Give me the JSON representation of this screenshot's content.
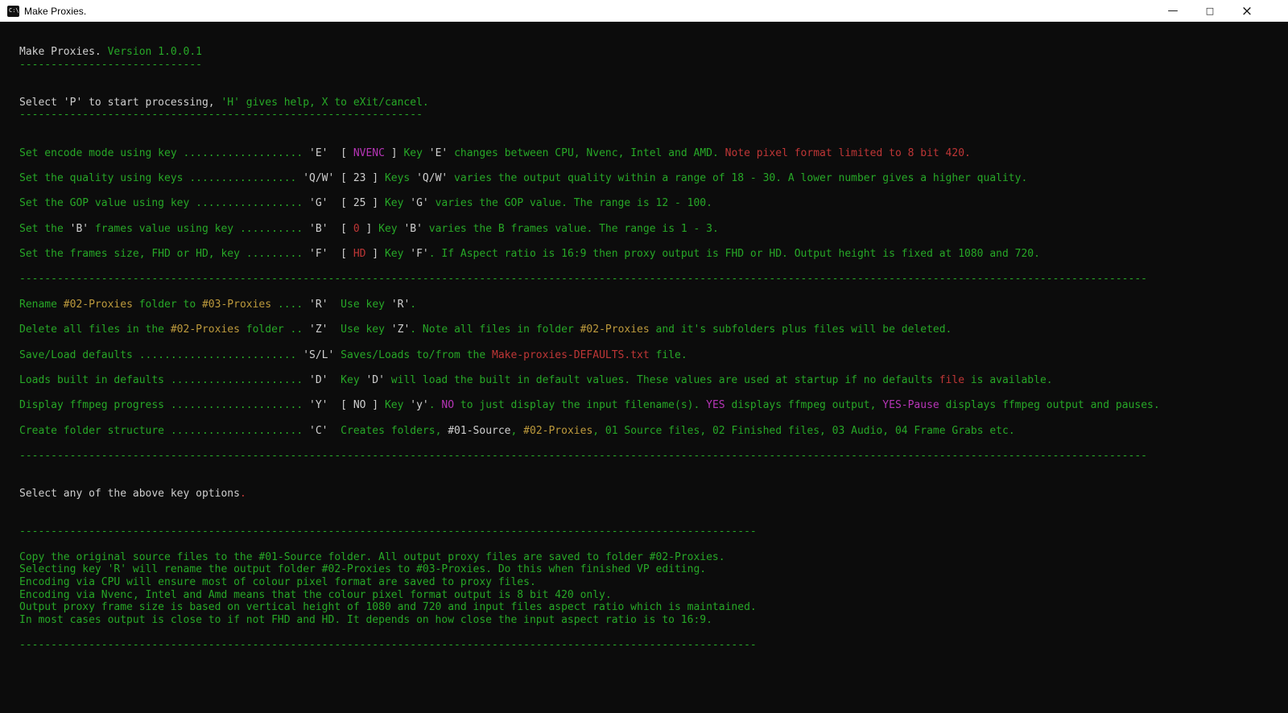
{
  "window": {
    "title": "Make Proxies.",
    "icon_glyph": "C:\\",
    "controls": {
      "minimize": "—",
      "maximize": "□",
      "close": "×"
    }
  },
  "colors": {
    "g": "#27a827",
    "w": "#cfcfcf",
    "r": "#bf3636",
    "m": "#b735b7",
    "y": "#bd9a3c",
    "titlebar_bg": "#ffffff",
    "console_bg": "#0c0c0c"
  },
  "console": {
    "lines": [
      [
        {
          "c": "w",
          "t": "Make Proxies."
        },
        {
          "c": "g",
          "t": " Version 1.0.0.1"
        }
      ],
      [
        {
          "c": "g",
          "rep": "-",
          "n": 29
        }
      ],
      [],
      [],
      [
        {
          "c": "w",
          "t": "Select 'P' to start processing, "
        },
        {
          "c": "g",
          "t": "'H' gives help, X to eXit/cancel."
        }
      ],
      [
        {
          "c": "g",
          "rep": "-",
          "n": 64
        }
      ],
      [],
      [],
      [
        {
          "c": "g",
          "t": "Set encode mode using key ................... "
        },
        {
          "c": "w",
          "t": "'E'  [ "
        },
        {
          "c": "m",
          "t": "NVENC"
        },
        {
          "c": "w",
          "t": " ] "
        },
        {
          "c": "g",
          "t": "Key "
        },
        {
          "c": "w",
          "t": "'E'"
        },
        {
          "c": "g",
          "t": " changes between CPU, Nvenc, Intel and AMD. "
        },
        {
          "c": "r",
          "t": "Note pixel format limited to 8 bit 420."
        }
      ],
      [],
      [
        {
          "c": "g",
          "t": "Set the quality using keys ................. "
        },
        {
          "c": "w",
          "t": "'Q/W' [ 23 ] "
        },
        {
          "c": "g",
          "t": "Keys "
        },
        {
          "c": "w",
          "t": "'Q/W'"
        },
        {
          "c": "g",
          "t": " varies the output quality within a range of 18 - 30. A lower number gives a higher quality."
        }
      ],
      [],
      [
        {
          "c": "g",
          "t": "Set the GOP value using key ................. "
        },
        {
          "c": "w",
          "t": "'G'  [ 25 ] "
        },
        {
          "c": "g",
          "t": "Key "
        },
        {
          "c": "w",
          "t": "'G'"
        },
        {
          "c": "g",
          "t": " varies the GOP value. The range is 12 - 100."
        }
      ],
      [],
      [
        {
          "c": "g",
          "t": "Set the "
        },
        {
          "c": "w",
          "t": "'B'"
        },
        {
          "c": "g",
          "t": " frames value using key .......... "
        },
        {
          "c": "w",
          "t": "'B'  [ "
        },
        {
          "c": "r",
          "t": "0"
        },
        {
          "c": "w",
          "t": " ] "
        },
        {
          "c": "g",
          "t": "Key "
        },
        {
          "c": "w",
          "t": "'B'"
        },
        {
          "c": "g",
          "t": " varies the B frames value. The range is 1 - 3."
        }
      ],
      [],
      [
        {
          "c": "g",
          "t": "Set the frames size, FHD or HD, key ......... "
        },
        {
          "c": "w",
          "t": "'F'  [ "
        },
        {
          "c": "r",
          "t": "HD"
        },
        {
          "c": "w",
          "t": " ] "
        },
        {
          "c": "g",
          "t": "Key "
        },
        {
          "c": "w",
          "t": "'F'"
        },
        {
          "c": "g",
          "t": ". If Aspect ratio is 16:9 then proxy output is FHD or HD. Output height is fixed at 1080 and 720."
        }
      ],
      [],
      [
        {
          "c": "g",
          "rep": "-",
          "n": 179
        }
      ],
      [],
      [
        {
          "c": "g",
          "t": "Rename "
        },
        {
          "c": "y",
          "t": "#02-Proxies"
        },
        {
          "c": "g",
          "t": " folder to "
        },
        {
          "c": "y",
          "t": "#03-Proxies"
        },
        {
          "c": "g",
          "t": " .... "
        },
        {
          "c": "w",
          "t": "'R'"
        },
        {
          "c": "g",
          "t": "  Use key "
        },
        {
          "c": "w",
          "t": "'R'"
        },
        {
          "c": "g",
          "t": "."
        }
      ],
      [],
      [
        {
          "c": "g",
          "t": "Delete all files in the "
        },
        {
          "c": "y",
          "t": "#02-Proxies"
        },
        {
          "c": "g",
          "t": " folder .. "
        },
        {
          "c": "w",
          "t": "'Z'"
        },
        {
          "c": "g",
          "t": "  Use key "
        },
        {
          "c": "w",
          "t": "'Z'"
        },
        {
          "c": "g",
          "t": ". Note all files in folder "
        },
        {
          "c": "y",
          "t": "#02-Proxies"
        },
        {
          "c": "g",
          "t": " and it's subfolders plus files will be deleted."
        }
      ],
      [],
      [
        {
          "c": "g",
          "t": "Save/Load defaults ......................... "
        },
        {
          "c": "w",
          "t": "'S/L'"
        },
        {
          "c": "g",
          "t": " Saves/Loads to/from the "
        },
        {
          "c": "r",
          "t": "Make-proxies-DEFAULTS.txt"
        },
        {
          "c": "g",
          "t": " file."
        }
      ],
      [],
      [
        {
          "c": "g",
          "t": "Loads built in defaults ..................... "
        },
        {
          "c": "w",
          "t": "'D'"
        },
        {
          "c": "g",
          "t": "  Key "
        },
        {
          "c": "w",
          "t": "'D'"
        },
        {
          "c": "g",
          "t": " will load the built in default values. These values are used at startup if no defaults "
        },
        {
          "c": "r",
          "t": "file"
        },
        {
          "c": "g",
          "t": " is available."
        }
      ],
      [],
      [
        {
          "c": "g",
          "t": "Display ffmpeg progress ..................... "
        },
        {
          "c": "w",
          "t": "'Y'  [ NO ] "
        },
        {
          "c": "g",
          "t": "Key "
        },
        {
          "c": "w",
          "t": "'y'"
        },
        {
          "c": "g",
          "t": ". "
        },
        {
          "c": "m",
          "t": "NO"
        },
        {
          "c": "g",
          "t": " to just display the input filename(s). "
        },
        {
          "c": "m",
          "t": "YES"
        },
        {
          "c": "g",
          "t": " displays ffmpeg output, "
        },
        {
          "c": "m",
          "t": "YES-Pause"
        },
        {
          "c": "g",
          "t": " displays ffmpeg output and pauses."
        }
      ],
      [],
      [
        {
          "c": "g",
          "t": "Create folder structure ..................... "
        },
        {
          "c": "w",
          "t": "'C'"
        },
        {
          "c": "g",
          "t": "  Creates folders, "
        },
        {
          "c": "w",
          "t": "#01-Source"
        },
        {
          "c": "g",
          "t": ", "
        },
        {
          "c": "y",
          "t": "#02-Proxies"
        },
        {
          "c": "g",
          "t": ", 01 Source files, 02 Finished files, 03 Audio, 04 Frame Grabs etc."
        }
      ],
      [],
      [
        {
          "c": "g",
          "rep": "-",
          "n": 179
        }
      ],
      [],
      [],
      [
        {
          "c": "w",
          "t": "Select any of the above key options"
        },
        {
          "c": "r",
          "t": "."
        }
      ],
      [],
      [],
      [
        {
          "c": "g",
          "rep": "-",
          "n": 117
        }
      ],
      [],
      [
        {
          "c": "g",
          "t": "Copy the original source files to the #01-Source folder. All output proxy files are saved to folder #02-Proxies."
        }
      ],
      [
        {
          "c": "g",
          "t": "Selecting key 'R' will rename the output folder #02-Proxies to #03-Proxies. Do this when finished VP editing."
        }
      ],
      [
        {
          "c": "g",
          "t": "Encoding via CPU will ensure most of colour pixel format are saved to proxy files."
        }
      ],
      [
        {
          "c": "g",
          "t": "Encoding via Nvenc, Intel and Amd means that the colour pixel format output is 8 bit 420 only."
        }
      ],
      [
        {
          "c": "g",
          "t": "Output proxy frame size is based on vertical height of 1080 and 720 and input files aspect ratio which is maintained."
        }
      ],
      [
        {
          "c": "g",
          "t": "In most cases output is close to if not FHD and HD. It depends on how close the input aspect ratio is to 16:9."
        }
      ],
      [],
      [
        {
          "c": "g",
          "rep": "-",
          "n": 117
        }
      ]
    ]
  }
}
